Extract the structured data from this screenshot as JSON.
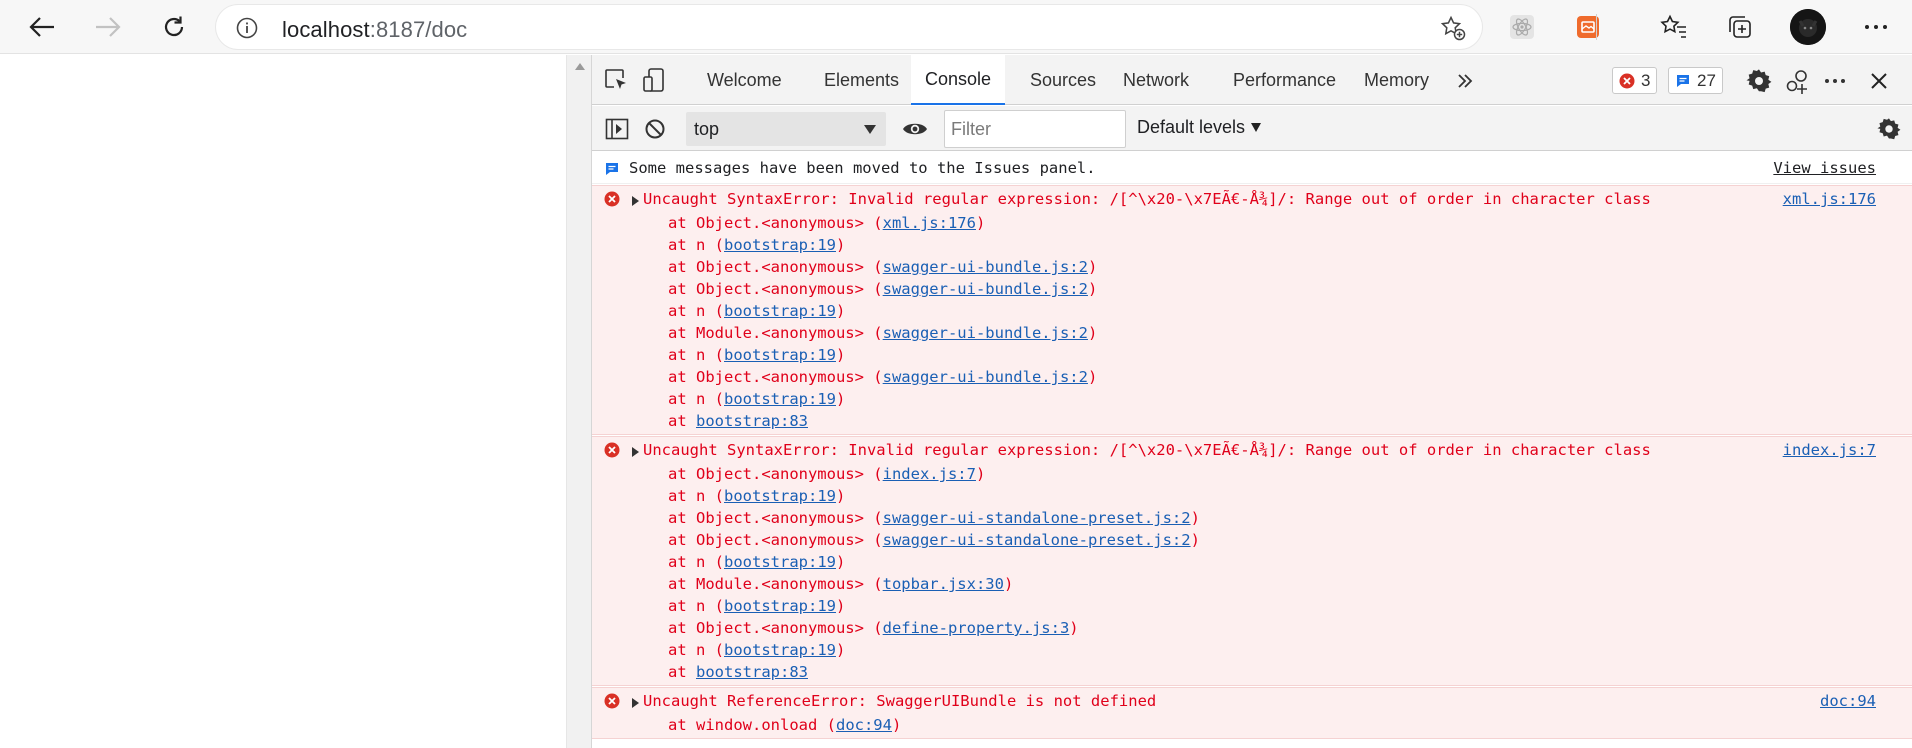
{
  "browser": {
    "url_host": "localhost",
    "url_path": ":8187/doc"
  },
  "devtools": {
    "tabs": [
      "Welcome",
      "Elements",
      "Console",
      "Sources",
      "Network",
      "Performance",
      "Memory"
    ],
    "active_tab": "Console",
    "error_count": "3",
    "message_count": "27",
    "context": "top",
    "filter_placeholder": "Filter",
    "levels": "Default levels"
  },
  "console": {
    "info_message": "Some messages have been moved to the Issues panel.",
    "view_issues": "View issues",
    "errors": [
      {
        "message": "Uncaught SyntaxError: Invalid regular expression: /[^\\x20-\\x7EÃ€-Å¾]/: Range out of order in character class",
        "source": "xml.js:176",
        "frames": [
          {
            "prefix": "at Object.<anonymous> (",
            "link": "xml.js:176",
            "suffix": ")"
          },
          {
            "prefix": "at n (",
            "link": "bootstrap:19",
            "suffix": ")"
          },
          {
            "prefix": "at Object.<anonymous> (",
            "link": "swagger-ui-bundle.js:2",
            "suffix": ")"
          },
          {
            "prefix": "at Object.<anonymous> (",
            "link": "swagger-ui-bundle.js:2",
            "suffix": ")"
          },
          {
            "prefix": "at n (",
            "link": "bootstrap:19",
            "suffix": ")"
          },
          {
            "prefix": "at Module.<anonymous> (",
            "link": "swagger-ui-bundle.js:2",
            "suffix": ")"
          },
          {
            "prefix": "at n (",
            "link": "bootstrap:19",
            "suffix": ")"
          },
          {
            "prefix": "at Object.<anonymous> (",
            "link": "swagger-ui-bundle.js:2",
            "suffix": ")"
          },
          {
            "prefix": "at n (",
            "link": "bootstrap:19",
            "suffix": ")"
          },
          {
            "prefix": "at ",
            "link": "bootstrap:83",
            "suffix": ""
          }
        ]
      },
      {
        "message": "Uncaught SyntaxError: Invalid regular expression: /[^\\x20-\\x7EÃ€-Å¾]/: Range out of order in character class",
        "source": "index.js:7",
        "frames": [
          {
            "prefix": "at Object.<anonymous> (",
            "link": "index.js:7",
            "suffix": ")"
          },
          {
            "prefix": "at n (",
            "link": "bootstrap:19",
            "suffix": ")"
          },
          {
            "prefix": "at Object.<anonymous> (",
            "link": "swagger-ui-standalone-preset.js:2",
            "suffix": ")"
          },
          {
            "prefix": "at Object.<anonymous> (",
            "link": "swagger-ui-standalone-preset.js:2",
            "suffix": ")"
          },
          {
            "prefix": "at n (",
            "link": "bootstrap:19",
            "suffix": ")"
          },
          {
            "prefix": "at Module.<anonymous> (",
            "link": "topbar.jsx:30",
            "suffix": ")"
          },
          {
            "prefix": "at n (",
            "link": "bootstrap:19",
            "suffix": ")"
          },
          {
            "prefix": "at Object.<anonymous> (",
            "link": "define-property.js:3",
            "suffix": ")"
          },
          {
            "prefix": "at n (",
            "link": "bootstrap:19",
            "suffix": ")"
          },
          {
            "prefix": "at ",
            "link": "bootstrap:83",
            "suffix": ""
          }
        ]
      },
      {
        "message": "Uncaught ReferenceError: SwaggerUIBundle is not defined",
        "source": "doc:94",
        "frames": [
          {
            "prefix": "at window.onload (",
            "link": "doc:94",
            "suffix": ")"
          }
        ]
      }
    ]
  }
}
